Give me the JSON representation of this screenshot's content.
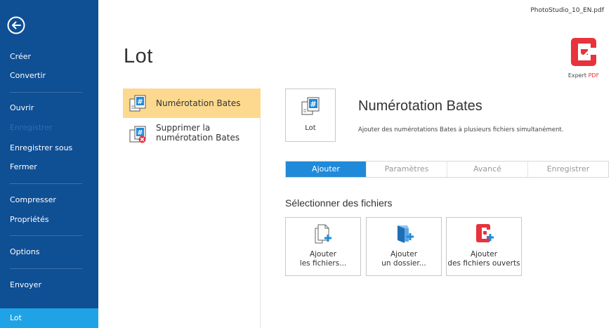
{
  "file": {
    "name": "PhotoStudio_10_EN.pdf"
  },
  "sidebar": {
    "items": [
      {
        "label": "Créer"
      },
      {
        "label": "Convertir"
      },
      {
        "label": "Ouvrir"
      },
      {
        "label": "Enregistrer",
        "disabled": true
      },
      {
        "label": "Enregistrer sous"
      },
      {
        "label": "Fermer"
      },
      {
        "label": "Compresser"
      },
      {
        "label": "Propriétés"
      },
      {
        "label": "Options"
      },
      {
        "label": "Envoyer"
      },
      {
        "label": "Lot",
        "selected": true
      }
    ]
  },
  "page": {
    "title": "Lot"
  },
  "logo": {
    "text_part1": "Expert ",
    "text_part2": "PDF"
  },
  "commands": [
    {
      "label": "Numérotation Bates",
      "selected": true
    },
    {
      "label_line1": "Supprimer la",
      "label_line2": "numérotation Bates"
    }
  ],
  "panel": {
    "tile_label": "Lot",
    "title": "Numérotation Bates",
    "description": "Ajouter des numérotations Bates à plusieurs fichiers simultanément.",
    "tabs": [
      {
        "label": "Ajouter",
        "active": true
      },
      {
        "label": "Paramètres"
      },
      {
        "label": "Avancé"
      },
      {
        "label": "Enregistrer"
      }
    ],
    "section_title": "Sélectionner des fichiers",
    "actions": [
      {
        "line1": "Ajouter",
        "line2": "les fichiers..."
      },
      {
        "line1": "Ajouter",
        "line2": "un dossier..."
      },
      {
        "line1": "Ajouter",
        "line2": "des fichiers ouverts"
      }
    ]
  },
  "colors": {
    "sidebar_bg": "#0f4f94",
    "sidebar_selected": "#1fa3e6",
    "selected_command_bg": "#fcd98f",
    "active_tab": "#1f8ad9",
    "brand_red": "#e8323c"
  }
}
